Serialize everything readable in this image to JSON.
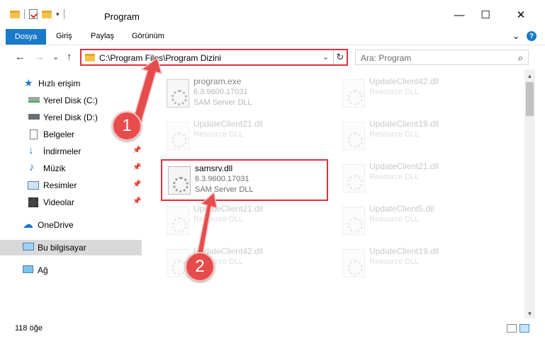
{
  "window": {
    "title": "Program",
    "minimize": "—",
    "maximize": "☐",
    "close": "✕"
  },
  "ribbon": {
    "tabs": [
      "Dosya",
      "Giriş",
      "Paylaş",
      "Görünüm"
    ],
    "expand": "⌄",
    "help": "?"
  },
  "nav": {
    "back": "←",
    "forward": "→",
    "recent": "⌄",
    "up": "↑",
    "address": "C:\\Program Files\\Program Dizini",
    "address_dropdown": "⌄",
    "refresh": "↻",
    "search_placeholder": "Ara: Program",
    "search_icon": "⌕"
  },
  "sidebar": {
    "items": [
      {
        "label": "Hızlı erişim",
        "icon": "star-icon"
      },
      {
        "label": "Yerel Disk (C:)",
        "icon": "drive-icon"
      },
      {
        "label": "Yerel Disk (D:)",
        "icon": "drive-icon"
      },
      {
        "label": "Belgeler",
        "icon": "documents-icon"
      },
      {
        "label": "İndirmeler",
        "icon": "download-icon"
      },
      {
        "label": "Müzik",
        "icon": "music-icon"
      },
      {
        "label": "Resimler",
        "icon": "pictures-icon"
      },
      {
        "label": "Videolar",
        "icon": "videos-icon"
      },
      {
        "label": "OneDrive",
        "icon": "cloud-icon"
      },
      {
        "label": "Bu bilgisayar",
        "icon": "computer-icon"
      },
      {
        "label": "Ağ",
        "icon": "network-icon"
      }
    ]
  },
  "files": [
    {
      "name": "program.exe",
      "version": "6.3.9600.17031",
      "desc": "SAM Server DLL"
    },
    {
      "name": "UpdateClient42.dll",
      "version": "",
      "desc": "Resource DLL"
    },
    {
      "name": "UpdateClient21.dll",
      "version": "",
      "desc": "Resource DLL"
    },
    {
      "name": "UpdateClient19.dll",
      "version": "",
      "desc": "Resource DLL"
    },
    {
      "name": "samsrv.dll",
      "version": "6.3.9600.17031",
      "desc": "SAM Server DLL"
    },
    {
      "name": "UpdateClient21.dll",
      "version": "",
      "desc": "Resource DLL"
    },
    {
      "name": "UpdateClient21.dll",
      "version": "",
      "desc": "Resource DLL"
    },
    {
      "name": "UpdateClient5.dll",
      "version": "",
      "desc": "Resource DLL"
    },
    {
      "name": "UpdateClient42.dll",
      "version": "",
      "desc": "Resource DLL"
    },
    {
      "name": "UpdateClient19.dll",
      "version": "",
      "desc": "Resource DLL"
    }
  ],
  "status": {
    "count": "118 öğe"
  },
  "callouts": [
    "1",
    "2"
  ],
  "colors": {
    "accent": "#1979ca",
    "highlight": "#e0303a",
    "callout": "#e74c4c"
  }
}
